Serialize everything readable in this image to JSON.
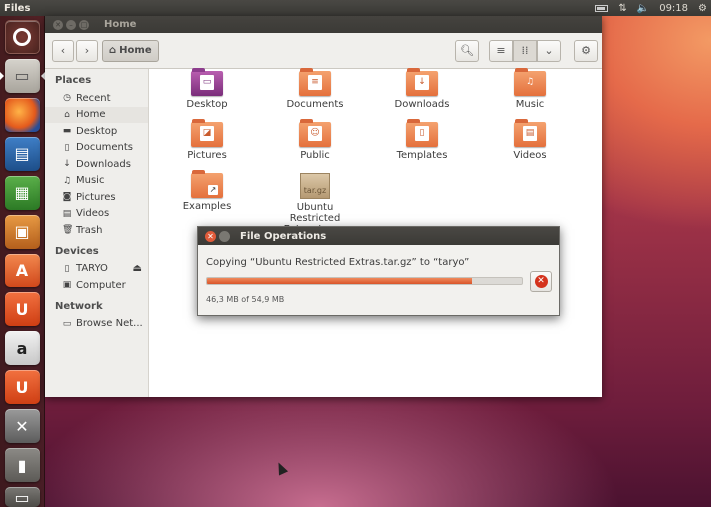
{
  "panel": {
    "app_name": "Files",
    "clock": "09:18",
    "network_icon": "arrows-updown-icon",
    "volume_icon": "speaker-icon",
    "settings_icon": "gear-icon",
    "battery_icon": "battery-icon"
  },
  "launcher": {
    "items": [
      "ubuntu-dash-icon",
      "files-icon",
      "firefox-icon",
      "writer-icon",
      "calc-icon",
      "impress-icon",
      "software-center-icon",
      "ubuntu-one-icon",
      "amazon-icon",
      "ubuntu-one-music-icon",
      "system-settings-icon",
      "usb-drive-icon",
      "trash-icon"
    ]
  },
  "window": {
    "title": "Home",
    "path_button": "Home",
    "sidebar": {
      "places_header": "Places",
      "places": [
        "Recent",
        "Home",
        "Desktop",
        "Documents",
        "Downloads",
        "Music",
        "Pictures",
        "Videos",
        "Trash"
      ],
      "devices_header": "Devices",
      "devices": [
        "TARYO",
        "Computer"
      ],
      "network_header": "Network",
      "network": [
        "Browse Net..."
      ]
    },
    "files": [
      {
        "name": "Desktop"
      },
      {
        "name": "Documents"
      },
      {
        "name": "Downloads"
      },
      {
        "name": "Music"
      },
      {
        "name": "Pictures"
      },
      {
        "name": "Public"
      },
      {
        "name": "Templates"
      },
      {
        "name": "Videos"
      },
      {
        "name": "Examples"
      },
      {
        "name": "Ubuntu Restricted Extras.tar.gz",
        "badge": "tar.gz"
      }
    ]
  },
  "dialog": {
    "title": "File Operations",
    "message": "Copying “Ubuntu Restricted Extras.tar.gz” to “taryo”",
    "progress_fraction": 0.84,
    "status": "46,3 MB of 54,9 MB"
  },
  "colors": {
    "accent": "#dd4814",
    "panel": "#3c3b37"
  }
}
